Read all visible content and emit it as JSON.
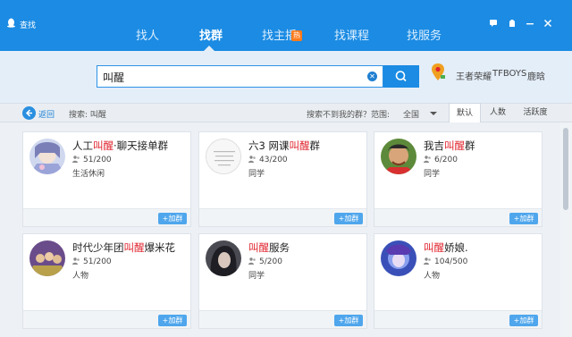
{
  "window": {
    "title": "查找",
    "controls": [
      "feedback-icon",
      "skin-icon",
      "minimize-icon",
      "close-icon"
    ]
  },
  "nav": {
    "tabs": [
      {
        "label": "找人",
        "active": false
      },
      {
        "label": "找群",
        "active": true
      },
      {
        "label": "找主播",
        "active": false,
        "badge": "热"
      },
      {
        "label": "找课程",
        "active": false
      },
      {
        "label": "找服务",
        "active": false
      }
    ]
  },
  "search": {
    "value": "叫醒",
    "hot_words": [
      "王者荣耀",
      "TFBOYS",
      "鹿晗"
    ]
  },
  "filter": {
    "back_label": "返回",
    "search_label": "搜索: 叫醒",
    "not_found_label": "搜索不到我的群？",
    "range_label": "范围:",
    "range_value": "全国",
    "sort_tabs": [
      {
        "label": "默认",
        "active": true
      },
      {
        "label": "人数",
        "active": false
      },
      {
        "label": "活跃度",
        "active": false
      }
    ]
  },
  "results": [
    {
      "name_pre": "人工",
      "name_hl": "叫醒",
      "name_post": "·聊天接单群",
      "members": "51/200",
      "category": "生活休闲",
      "join_label": "+加群"
    },
    {
      "name_pre": "六3 网课",
      "name_hl": "叫醒",
      "name_post": "群",
      "members": "43/200",
      "category": "同学",
      "join_label": "+加群"
    },
    {
      "name_pre": "我吉",
      "name_hl": "叫醒",
      "name_post": "群",
      "members": "6/200",
      "category": "同学",
      "join_label": "+加群"
    },
    {
      "name_pre": "时代少年团",
      "name_hl": "叫醒",
      "name_post": "爆米花",
      "members": "51/200",
      "category": "人物",
      "join_label": "+加群"
    },
    {
      "name_pre": "",
      "name_hl": "叫醒",
      "name_post": "服务",
      "members": "5/200",
      "category": "同学",
      "join_label": "+加群"
    },
    {
      "name_pre": "",
      "name_hl": "叫醒",
      "name_post": "娇娘.",
      "members": "104/500",
      "category": "人物",
      "join_label": "+加群"
    }
  ],
  "colors": {
    "brand_blue": "#1b8be3",
    "highlight_red": "#e0262f",
    "hot_orange": "#ff7b1c"
  }
}
